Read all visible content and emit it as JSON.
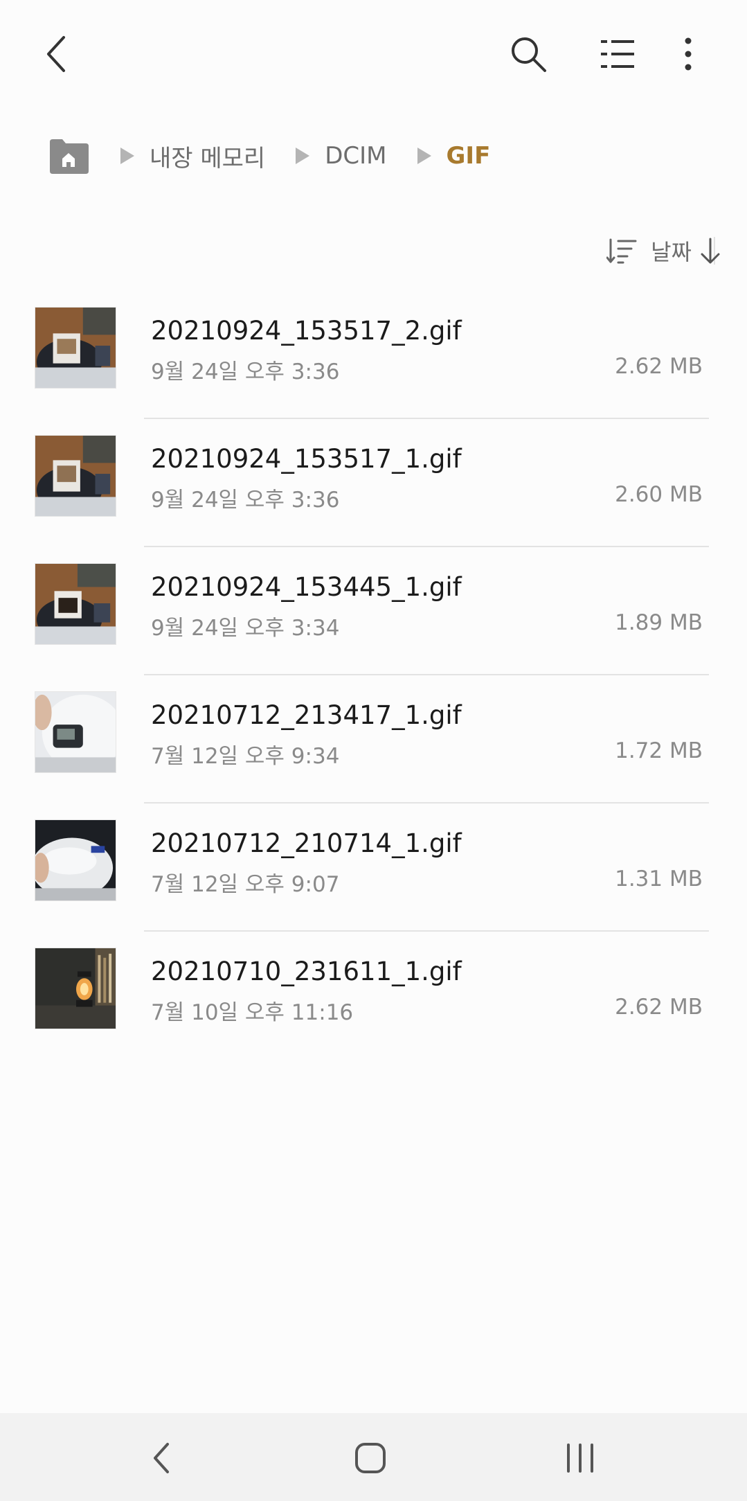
{
  "appbar": {
    "back_icon": "chevron-left-icon",
    "search_icon": "search-icon",
    "view_icon": "list-view-icon",
    "more_icon": "more-vertical-icon"
  },
  "breadcrumb": {
    "home_icon": "home-folder-icon",
    "items": [
      {
        "label": "내장 메모리"
      },
      {
        "label": "DCIM"
      },
      {
        "label": "GIF"
      }
    ],
    "current_color": "#a87a2e"
  },
  "sort": {
    "label": "날짜",
    "sort_icon": "sort-icon",
    "order_icon": "arrow-down-icon"
  },
  "files": [
    {
      "name": "20210924_153517_2.gif",
      "date": "9월 24일 오후 3:36",
      "size": "2.62 MB"
    },
    {
      "name": "20210924_153517_1.gif",
      "date": "9월 24일 오후 3:36",
      "size": "2.60 MB"
    },
    {
      "name": "20210924_153445_1.gif",
      "date": "9월 24일 오후 3:34",
      "size": "1.89 MB"
    },
    {
      "name": "20210712_213417_1.gif",
      "date": "7월 12일 오후 9:34",
      "size": "1.72 MB"
    },
    {
      "name": "20210712_210714_1.gif",
      "date": "7월 12일 오후 9:07",
      "size": "1.31 MB"
    },
    {
      "name": "20210710_231611_1.gif",
      "date": "7월 10일 오후 11:16",
      "size": "2.62 MB"
    }
  ],
  "navbar": {
    "back_icon": "nav-back-icon",
    "home_icon": "nav-home-icon",
    "recents_icon": "nav-recents-icon"
  }
}
